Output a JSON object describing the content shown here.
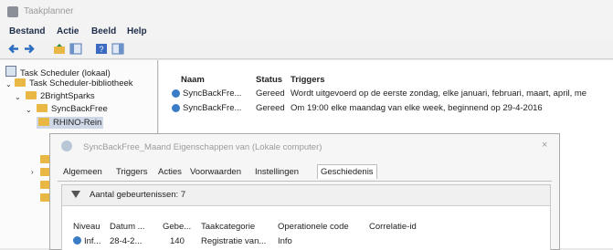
{
  "window": {
    "title": "Taakplanner"
  },
  "menu": [
    "Bestand",
    "Actie",
    "Beeld",
    "Help"
  ],
  "toolbar": {
    "icons": [
      "back-arrow-icon",
      "forward-arrow-icon",
      "folder-up-icon",
      "show-hide-console-tree-icon",
      "help-icon",
      "action-pane-icon"
    ]
  },
  "tree": {
    "root": "Task Scheduler (lokaal)",
    "library": "Task Scheduler-bibliotheek",
    "folder1": "2BrightSparks",
    "folder2": "SyncBackFree",
    "selected": "RHINO-Rein"
  },
  "tasks": {
    "headers": [
      "Naam",
      "Status",
      "Triggers"
    ],
    "rows": [
      {
        "name": "SyncBackFre...",
        "status": "Gereed",
        "trigger": "Wordt uitgevoerd op de eerste zondag, elke januari, februari, maart, april, me"
      },
      {
        "name": "SyncBackFre...",
        "status": "Gereed",
        "trigger": "Om 19:00 elke maandag van elke week, beginnend op 29-4-2016"
      }
    ]
  },
  "dialog": {
    "title": "SyncBackFree_Maand Eigenschappen van (Lokale computer)",
    "close": "×",
    "tabs": [
      "Algemeen",
      "Triggers",
      "Acties",
      "Voorwaarden",
      "Instellingen",
      "Geschiedenis"
    ],
    "active_tab": "Geschiedenis",
    "event_count": "Aantal gebeurtenissen: 7",
    "columns": [
      "Niveau",
      "Datum ...",
      "Gebe...",
      "Taakcategorie",
      "Operationele code",
      "Correlatie-id"
    ],
    "rows": [
      {
        "level": "Inf...",
        "date": "28-4-2...",
        "event": "140",
        "category": "Registratie van...",
        "opcode": "Info"
      }
    ]
  },
  "colors": {
    "accent": "#3b7cc6",
    "folder": "#e8b744",
    "selection": "#cfd8e6"
  }
}
